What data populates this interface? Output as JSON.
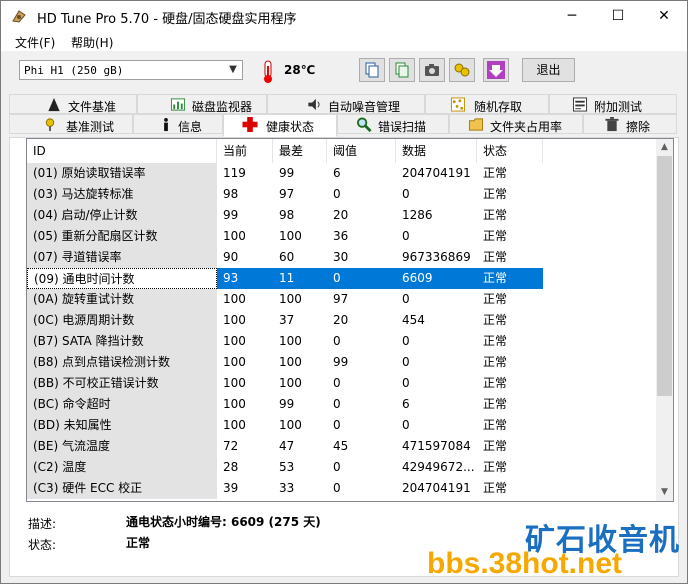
{
  "window": {
    "title": "HD Tune Pro 5.70 - 硬盘/固态硬盘实用程序",
    "minimize": "─",
    "maximize": "☐",
    "close": "✕"
  },
  "menu": [
    {
      "label": "文件(F)"
    },
    {
      "label": "帮助(H)"
    }
  ],
  "toolbar": {
    "drive": "Phi      H1 (250 gB)",
    "temperature": "28℃",
    "exit_label": "退出"
  },
  "tabs_row1": [
    "文件基准",
    "磁盘监视器",
    "自动噪音管理",
    "随机存取",
    "附加测试"
  ],
  "tabs_row2": [
    "基准测试",
    "信息",
    "健康状态",
    "错误扫描",
    "文件夹占用率",
    "擦除"
  ],
  "active_tab": "健康状态",
  "table": {
    "headers": [
      "ID",
      "当前",
      "最差",
      "阈值",
      "数据",
      "状态"
    ],
    "rows": [
      [
        "(01) 原始读取错误率",
        "119",
        "99",
        "6",
        "204704191",
        "正常"
      ],
      [
        "(03) 马达旋转标准",
        "98",
        "97",
        "0",
        "0",
        "正常"
      ],
      [
        "(04) 启动/停止计数",
        "99",
        "98",
        "20",
        "1286",
        "正常"
      ],
      [
        "(05) 重新分配扇区计数",
        "100",
        "100",
        "36",
        "0",
        "正常"
      ],
      [
        "(07) 寻道错误率",
        "90",
        "60",
        "30",
        "967336869",
        "正常"
      ],
      [
        "(09) 通电时间计数",
        "93",
        "11",
        "0",
        "6609",
        "正常"
      ],
      [
        "(0A) 旋转重试计数",
        "100",
        "100",
        "97",
        "0",
        "正常"
      ],
      [
        "(0C) 电源周期计数",
        "100",
        "37",
        "20",
        "454",
        "正常"
      ],
      [
        "(B7) SATA 降挡计数",
        "100",
        "100",
        "0",
        "0",
        "正常"
      ],
      [
        "(B8) 点到点错误检测计数",
        "100",
        "100",
        "99",
        "0",
        "正常"
      ],
      [
        "(BB) 不可校正错误计数",
        "100",
        "100",
        "0",
        "0",
        "正常"
      ],
      [
        "(BC) 命令超时",
        "100",
        "99",
        "0",
        "6",
        "正常"
      ],
      [
        "(BD) 未知属性",
        "100",
        "100",
        "0",
        "0",
        "正常"
      ],
      [
        "(BE) 气流温度",
        "72",
        "47",
        "45",
        "471597084",
        "正常"
      ],
      [
        "(C2) 温度",
        "28",
        "53",
        "0",
        "42949672...",
        "正常"
      ],
      [
        "(C3) 硬件 ECC 校正",
        "39",
        "33",
        "0",
        "204704191",
        "正常"
      ]
    ],
    "selected_row": 5
  },
  "details": {
    "desc_label": "描述:",
    "desc_value": "通电状态小时编号: 6609 (275 天)",
    "status_label": "状态:",
    "status_value": "正常"
  },
  "watermark": {
    "line1": "矿石收音机",
    "line2": "bbs.38hot.net"
  },
  "colors": {
    "selection": "#0078d7",
    "id_column": "#e3e3e3",
    "watermark_blue": "#1a6fc0",
    "watermark_orange": "#f6a800"
  }
}
